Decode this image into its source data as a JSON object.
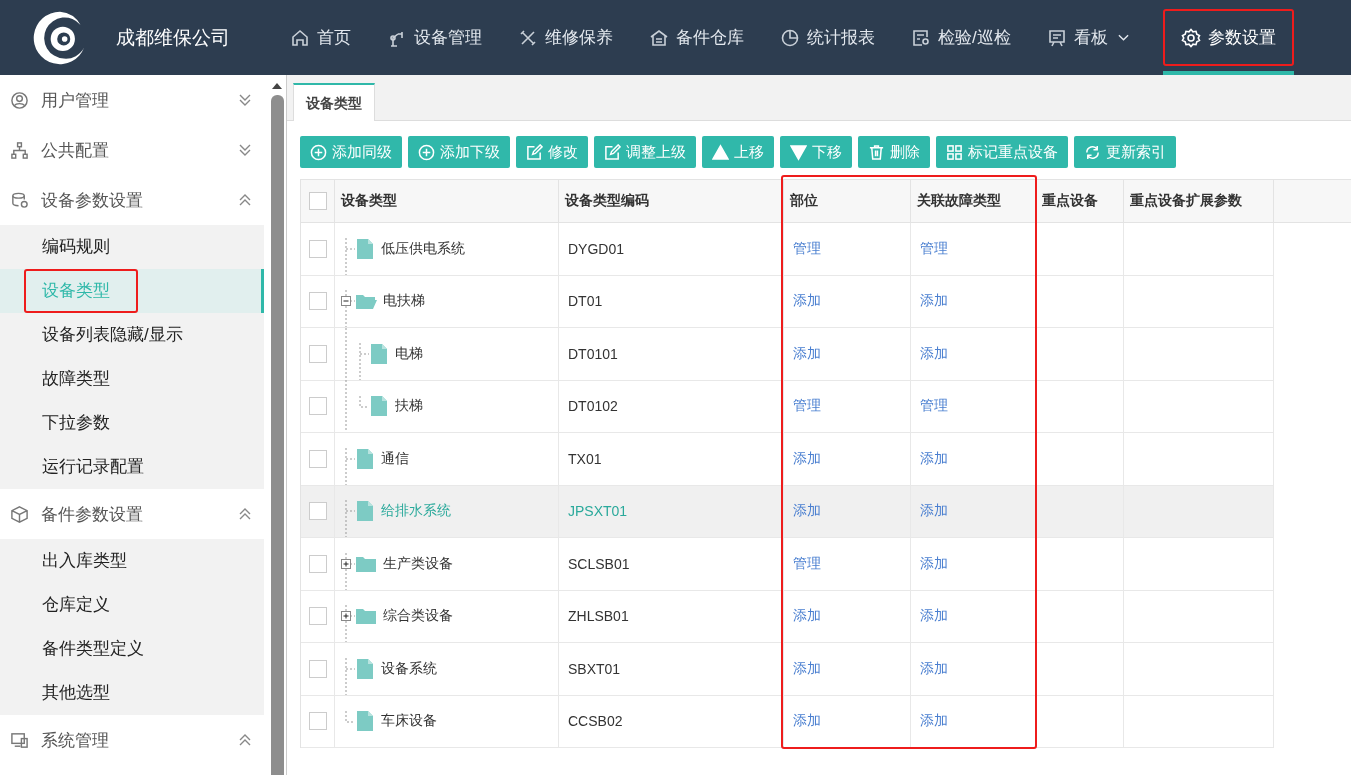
{
  "header": {
    "company": "成都维保公司",
    "nav": [
      {
        "label": "首页",
        "selected": false,
        "dropdown": false,
        "annotated": false
      },
      {
        "label": "设备管理",
        "selected": false,
        "dropdown": false,
        "annotated": false
      },
      {
        "label": "维修保养",
        "selected": false,
        "dropdown": false,
        "annotated": false
      },
      {
        "label": "备件仓库",
        "selected": false,
        "dropdown": false,
        "annotated": false
      },
      {
        "label": "统计报表",
        "selected": false,
        "dropdown": false,
        "annotated": false
      },
      {
        "label": "检验/巡检",
        "selected": false,
        "dropdown": false,
        "annotated": false
      },
      {
        "label": "看板",
        "selected": false,
        "dropdown": true,
        "annotated": false
      },
      {
        "label": "参数设置",
        "selected": true,
        "dropdown": false,
        "annotated": true
      }
    ]
  },
  "sidebar": {
    "groups": [
      {
        "label": "用户管理",
        "expanded": false
      },
      {
        "label": "公共配置",
        "expanded": false
      },
      {
        "label": "设备参数设置",
        "expanded": true,
        "items": [
          {
            "label": "编码规则",
            "selected": false,
            "annotated": false
          },
          {
            "label": "设备类型",
            "selected": true,
            "annotated": true
          },
          {
            "label": "设备列表隐藏/显示",
            "selected": false,
            "annotated": false
          },
          {
            "label": "故障类型",
            "selected": false,
            "annotated": false
          },
          {
            "label": "下拉参数",
            "selected": false,
            "annotated": false
          },
          {
            "label": "运行记录配置",
            "selected": false,
            "annotated": false
          }
        ]
      },
      {
        "label": "备件参数设置",
        "expanded": true,
        "items": [
          {
            "label": "出入库类型",
            "selected": false,
            "annotated": false
          },
          {
            "label": "仓库定义",
            "selected": false,
            "annotated": false
          },
          {
            "label": "备件类型定义",
            "selected": false,
            "annotated": false
          },
          {
            "label": "其他选型",
            "selected": false,
            "annotated": false
          }
        ]
      },
      {
        "label": "系统管理",
        "expanded": true
      }
    ]
  },
  "tabs": [
    {
      "label": "设备类型",
      "selected": true
    }
  ],
  "toolbar": [
    {
      "label": "添加同级"
    },
    {
      "label": "添加下级"
    },
    {
      "label": "修改"
    },
    {
      "label": "调整上级"
    },
    {
      "label": "上移"
    },
    {
      "label": "下移"
    },
    {
      "label": "删除"
    },
    {
      "label": "标记重点设备"
    },
    {
      "label": "更新索引"
    }
  ],
  "table": {
    "all_checked": false,
    "columns": [
      {
        "label": "设备类型",
        "annotated": false
      },
      {
        "label": "设备类型编码",
        "annotated": false
      },
      {
        "label": "部位",
        "annotated": true
      },
      {
        "label": "关联故障类型",
        "annotated": true
      },
      {
        "label": "重点设备",
        "annotated": false
      },
      {
        "label": "重点设备扩展参数",
        "annotated": false
      }
    ],
    "rows": [
      {
        "name": "低压供电系统",
        "code": "DYGD01",
        "parts": "管理",
        "faults": "管理",
        "kind": "file",
        "checked": false,
        "selected": false
      },
      {
        "name": "电扶梯",
        "code": "DT01",
        "parts": "添加",
        "faults": "添加",
        "kind": "folder",
        "expanded": true,
        "checked": false,
        "selected": false,
        "children": [
          {
            "name": "电梯",
            "code": "DT0101",
            "parts": "添加",
            "faults": "添加",
            "kind": "file",
            "checked": false,
            "selected": false
          },
          {
            "name": "扶梯",
            "code": "DT0102",
            "parts": "管理",
            "faults": "管理",
            "kind": "file",
            "checked": false,
            "selected": false
          }
        ]
      },
      {
        "name": "通信",
        "code": "TX01",
        "parts": "添加",
        "faults": "添加",
        "kind": "file",
        "checked": false,
        "selected": false
      },
      {
        "name": "给排水系统",
        "code": "JPSXT01",
        "parts": "添加",
        "faults": "添加",
        "kind": "file",
        "checked": false,
        "selected": true
      },
      {
        "name": "生产类设备",
        "code": "SCLSB01",
        "parts": "管理",
        "faults": "添加",
        "kind": "folder",
        "expanded": false,
        "checked": false,
        "selected": false
      },
      {
        "name": "综合类设备",
        "code": "ZHLSB01",
        "parts": "添加",
        "faults": "添加",
        "kind": "folder",
        "expanded": false,
        "checked": false,
        "selected": false
      },
      {
        "name": "设备系统",
        "code": "SBXT01",
        "parts": "添加",
        "faults": "添加",
        "kind": "file",
        "checked": false,
        "selected": false
      },
      {
        "name": "车床设备",
        "code": "CCSB02",
        "parts": "添加",
        "faults": "添加",
        "kind": "file",
        "checked": false,
        "selected": false
      }
    ]
  }
}
